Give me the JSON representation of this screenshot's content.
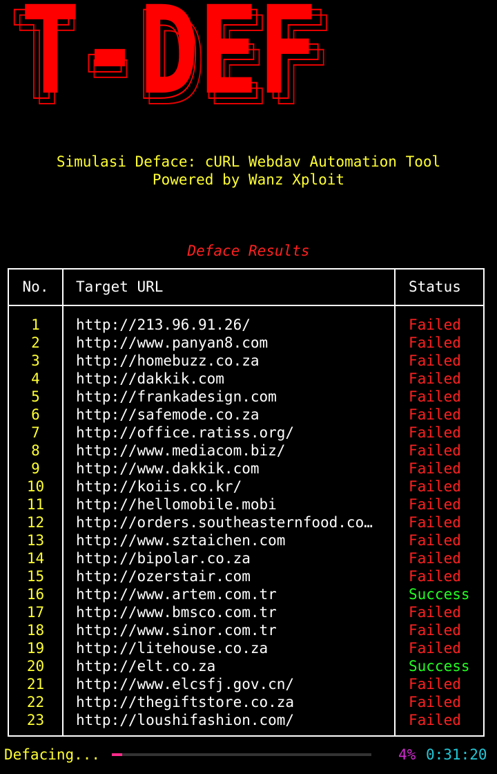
{
  "banner": {
    "text": "T-DEF",
    "color": "#ff0000"
  },
  "subtitle": {
    "line1": "Simulasi Deface: cURL Webdav Automation Tool",
    "line2": "Powered by Wanz Xploit"
  },
  "results_title": "Deface Results",
  "table": {
    "headers": {
      "no": "No.",
      "url": "Target URL",
      "status": "Status"
    },
    "rows": [
      {
        "no": "1",
        "url": "http://213.96.91.26/",
        "status": "Failed"
      },
      {
        "no": "2",
        "url": "http://www.panyan8.com",
        "status": "Failed"
      },
      {
        "no": "3",
        "url": "http://homebuzz.co.za",
        "status": "Failed"
      },
      {
        "no": "4",
        "url": "http://dakkik.com",
        "status": "Failed"
      },
      {
        "no": "5",
        "url": "http://frankadesign.com",
        "status": "Failed"
      },
      {
        "no": "6",
        "url": "http://safemode.co.za",
        "status": "Failed"
      },
      {
        "no": "7",
        "url": "http://office.ratiss.org/",
        "status": "Failed"
      },
      {
        "no": "8",
        "url": "http://www.mediacom.biz/",
        "status": "Failed"
      },
      {
        "no": "9",
        "url": "http://www.dakkik.com",
        "status": "Failed"
      },
      {
        "no": "10",
        "url": "http://koiis.co.kr/",
        "status": "Failed"
      },
      {
        "no": "11",
        "url": "http://hellomobile.mobi",
        "status": "Failed"
      },
      {
        "no": "12",
        "url": "http://orders.southeasternfood.co…",
        "status": "Failed"
      },
      {
        "no": "13",
        "url": "http://www.sztaichen.com",
        "status": "Failed"
      },
      {
        "no": "14",
        "url": "http://bipolar.co.za",
        "status": "Failed"
      },
      {
        "no": "15",
        "url": "http://ozerstair.com",
        "status": "Failed"
      },
      {
        "no": "16",
        "url": "http://www.artem.com.tr",
        "status": "Success"
      },
      {
        "no": "17",
        "url": "http://www.bmsco.com.tr",
        "status": "Failed"
      },
      {
        "no": "18",
        "url": "http://www.sinor.com.tr",
        "status": "Failed"
      },
      {
        "no": "19",
        "url": "http://litehouse.co.za",
        "status": "Failed"
      },
      {
        "no": "20",
        "url": "http://elt.co.za",
        "status": "Success"
      },
      {
        "no": "21",
        "url": "http://www.elcsfj.gov.cn/",
        "status": "Failed"
      },
      {
        "no": "22",
        "url": "http://thegiftstore.co.za",
        "status": "Failed"
      },
      {
        "no": "23",
        "url": "http://loushifashion.com/",
        "status": "Failed"
      }
    ]
  },
  "footer": {
    "label": "Defacing...",
    "progress_percent": 4,
    "percent_text": "4%",
    "elapsed": "0:31:20"
  },
  "colors": {
    "failed": "#ff2020",
    "success": "#22ff22",
    "accent_yellow": "#ffff33",
    "progress": "#ff2a8a"
  }
}
